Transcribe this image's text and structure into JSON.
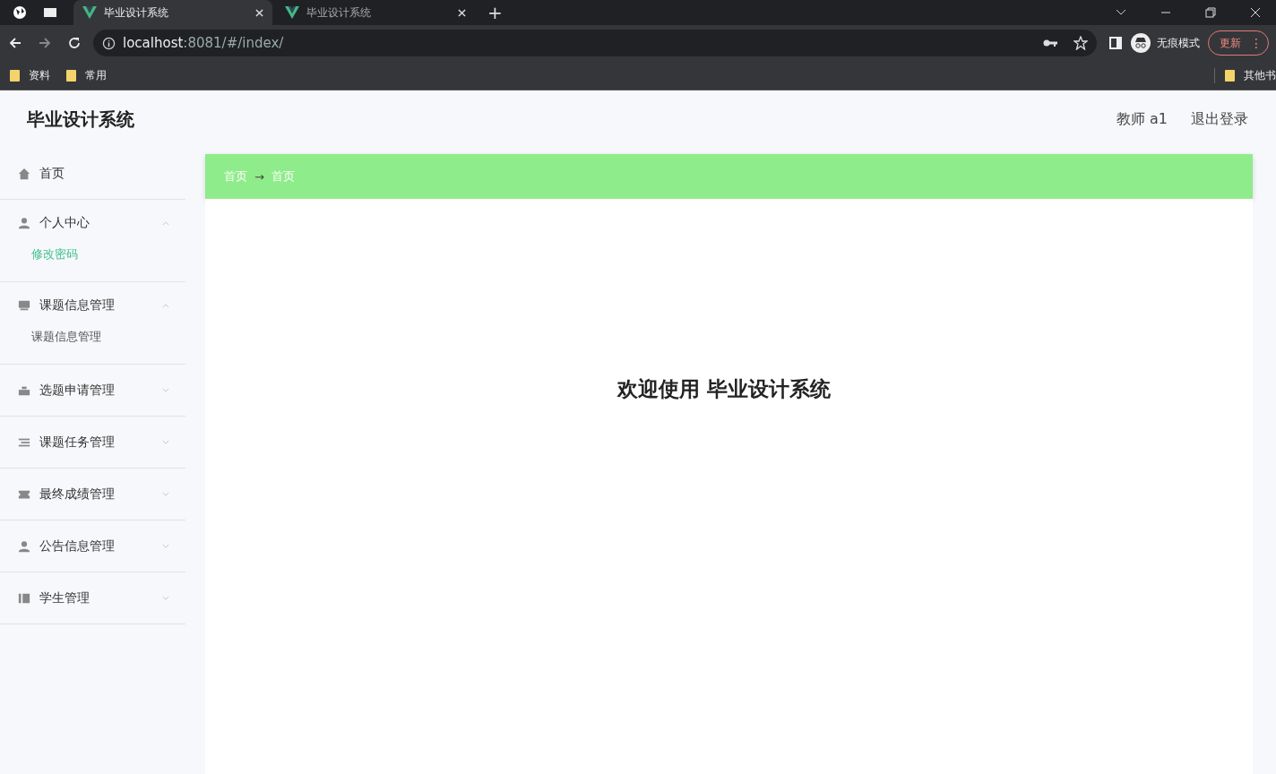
{
  "browser": {
    "tabs": [
      {
        "title": "毕业设计系统",
        "selected": true
      },
      {
        "title": "毕业设计系统",
        "selected": false
      }
    ],
    "new_tab": "+",
    "url_host": "localhost",
    "url_rest": ":8081/#/index/",
    "incognito": "无痕模式",
    "update": "更新",
    "menu_dots": "⋮",
    "bookmarks": [
      "资料",
      "常用"
    ],
    "other_bookmarks": "其他书"
  },
  "app": {
    "title": "毕业设计系统",
    "user": "教师 a1",
    "logout": "退出登录",
    "menu": [
      {
        "label": "首页"
      },
      {
        "label": "个人中心",
        "expanded": true,
        "children": [
          {
            "label": "修改密码",
            "selected": true
          }
        ]
      },
      {
        "label": "课题信息管理",
        "expanded": true,
        "children": [
          {
            "label": "课题信息管理",
            "selected": false
          }
        ]
      },
      {
        "label": "选题申请管理",
        "expanded": false
      },
      {
        "label": "课题任务管理",
        "expanded": false
      },
      {
        "label": "最终成绩管理",
        "expanded": false
      },
      {
        "label": "公告信息管理",
        "expanded": false
      },
      {
        "label": "学生管理",
        "expanded": false
      }
    ],
    "breadcrumb": [
      "首页",
      "首页"
    ],
    "breadcrumb_separator": "→",
    "welcome": "欢迎使用 毕业设计系统"
  }
}
